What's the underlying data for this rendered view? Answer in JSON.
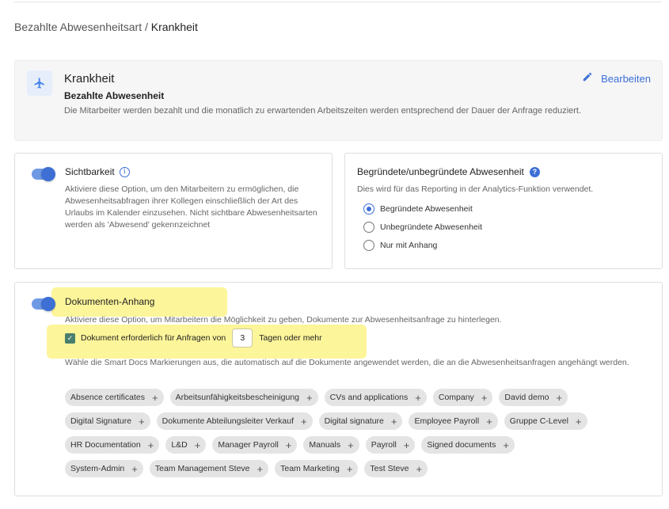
{
  "breadcrumb": {
    "parent": "Bezahlte Abwesenheitsart / ",
    "current": "Krankheit"
  },
  "header": {
    "icon": "airplane-icon",
    "title": "Krankheit",
    "subtitle": "Bezahlte Abwesenheit",
    "description": "Die Mitarbeiter werden bezahlt und die monatlich zu erwartenden Arbeitszeiten werden entsprechend der Dauer der Anfrage reduziert.",
    "edit_label": "Bearbeiten"
  },
  "visibility": {
    "enabled": true,
    "title": "Sichtbarkeit",
    "info_glyph": "i",
    "description": "Aktiviere diese Option, um den Mitarbeitern zu ermöglichen, die Abwesenheitsabfragen ihrer Kollegen einschließlich der Art des Urlaubs im Kalender einzusehen. Nicht sichtbare Abwesenheitsarten werden als 'Abwesend' gekennzeichnet"
  },
  "reason": {
    "title": "Begründete/unbegründete Abwesenheit",
    "help_glyph": "?",
    "description": "Dies wird für das Reporting in der Analytics-Funktion verwendet.",
    "options": [
      {
        "label": "Begründete Abwesenheit",
        "selected": true
      },
      {
        "label": "Unbegründete Abwesenheit",
        "selected": false
      },
      {
        "label": "Nur mit Anhang",
        "selected": false
      }
    ]
  },
  "documents": {
    "enabled": true,
    "title": "Dokumenten-Anhang",
    "description": "Aktiviere diese Option, um Mitarbeitern die Möglichkeit zu geben, Dokumente zur Abwesenheitsanfrage zu hinterlegen.",
    "required_checked": true,
    "required_label_before": "Dokument erforderlich für Anfragen von",
    "required_days": "3",
    "required_label_after": "Tagen oder mehr",
    "tags_description": "Wähle die Smart Docs Markierungen aus, die automatisch auf die Dokumente angewendet werden, die an die Abwesenheitsanfragen angehängt werden.",
    "tag_rows": [
      [
        "Absence certificates",
        "Arbeitsunfähigkeitsbescheinigung",
        "CVs and applications",
        "Company",
        "David demo"
      ],
      [
        "Digital Signature",
        "Dokumente Abteilungsleiter Verkauf",
        "Digital signature",
        "Employee Payroll",
        "Gruppe C-Level"
      ],
      [
        "HR Documentation",
        "L&D",
        "Manager Payroll",
        "Manuals",
        "Payroll",
        "Signed documents"
      ],
      [
        "System-Admin",
        "Team Management Steve",
        "Team Marketing",
        "Test Steve"
      ]
    ],
    "plus_glyph": "+"
  },
  "colors": {
    "accent": "#3c6fd6",
    "highlight": "#fdf59a",
    "checkbox": "#4a7f6d",
    "tag_bg": "#e4e4e4"
  }
}
